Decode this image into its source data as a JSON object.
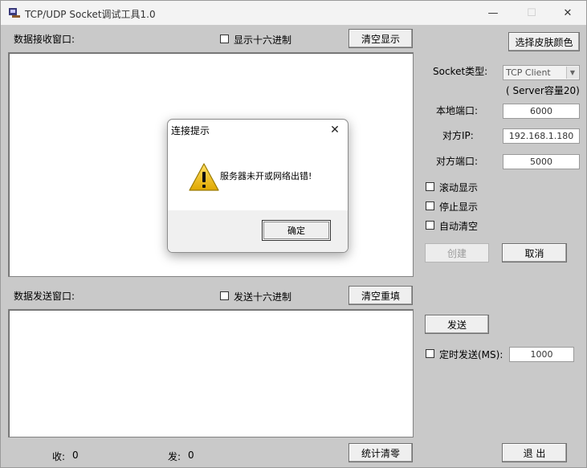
{
  "window": {
    "title": "TCP/UDP Socket调试工具1.0",
    "minimize": "—",
    "maximize": "☐",
    "close": "✕"
  },
  "receive": {
    "label": "数据接收窗口:",
    "hex_label": "显示十六进制",
    "clear_button": "清空显示"
  },
  "send": {
    "label": "数据发送窗口:",
    "hex_label": "发送十六进制",
    "clear_button": "清空重填"
  },
  "stats": {
    "recv_label": "收:",
    "recv_value": "0",
    "send_label": "发:",
    "send_value": "0",
    "clear_button": "统计清零"
  },
  "right": {
    "skin_button": "选择皮肤颜色",
    "socket_type_label": "Socket类型:",
    "socket_type_value": "TCP Client",
    "server_capacity": "( Server容量20)",
    "local_port_label": "本地端口:",
    "local_port_value": "6000",
    "remote_ip_label": "对方IP:",
    "remote_ip_value": "192.168.1.180",
    "remote_port_label": "对方端口:",
    "remote_port_value": "5000",
    "scroll_display": "滚动显示",
    "stop_display": "停止显示",
    "auto_clear": "自动清空",
    "create_button": "创建",
    "cancel_button": "取消",
    "send_button": "发送",
    "timed_send_label": "定时发送(MS):",
    "timed_send_value": "1000",
    "exit_button": "退 出"
  },
  "dialog": {
    "title": "连接提示",
    "message": "服务器未开或网络出错!",
    "ok_button": "确定",
    "close": "✕"
  }
}
